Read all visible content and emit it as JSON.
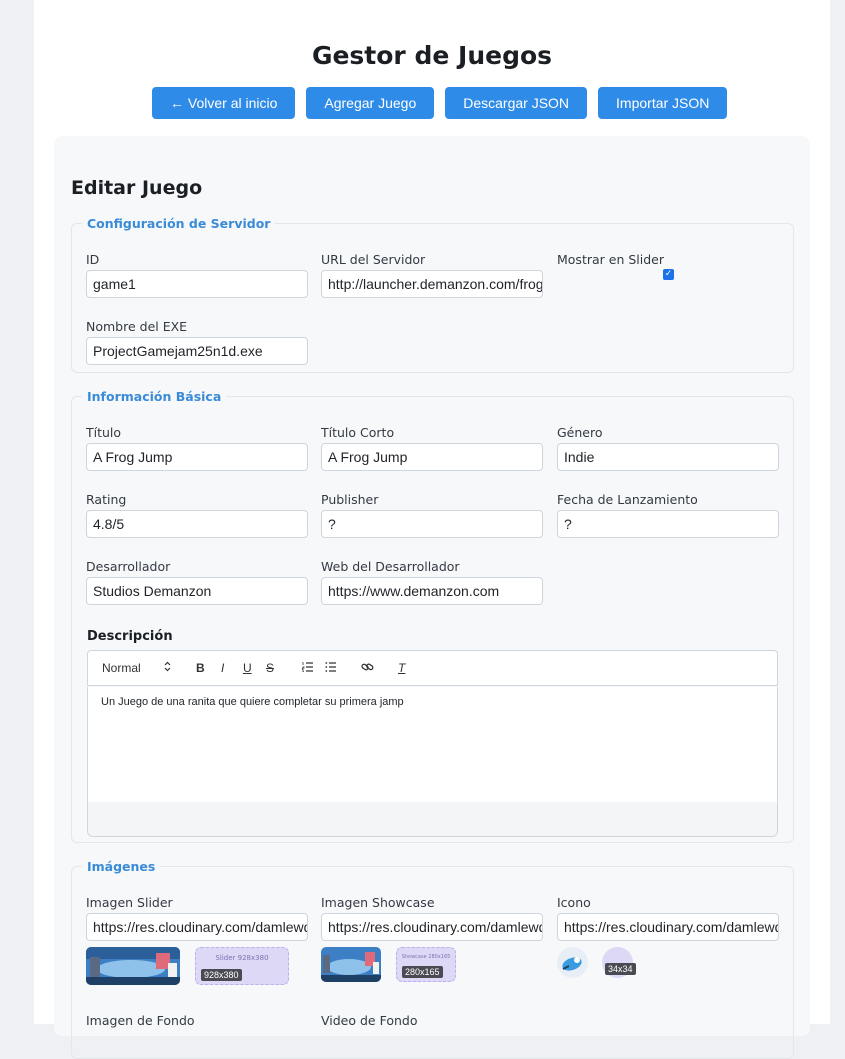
{
  "header": {
    "title": "Gestor de Juegos",
    "buttons": {
      "back": "← Volver al inicio",
      "add": "Agregar Juego",
      "download": "Descargar JSON",
      "import": "Importar JSON"
    }
  },
  "form": {
    "title": "Editar Juego",
    "server_section": {
      "legend": "Configuración de Servidor",
      "id_label": "ID",
      "id_value": "game1",
      "url_label": "URL del Servidor",
      "url_value": "http://launcher.demanzon.com/frog",
      "slider_label": "Mostrar en Slider",
      "slider_checked": true,
      "exe_label": "Nombre del EXE",
      "exe_value": "ProjectGamejam25n1d.exe"
    },
    "basic_section": {
      "legend": "Información Básica",
      "title_label": "Título",
      "title_value": "A Frog Jump",
      "short_title_label": "Título Corto",
      "short_title_value": "A Frog Jump",
      "genre_label": "Género",
      "genre_value": "Indie",
      "rating_label": "Rating",
      "rating_value": "4.8/5",
      "publisher_label": "Publisher",
      "publisher_value": "?",
      "release_label": "Fecha de Lanzamiento",
      "release_value": "?",
      "developer_label": "Desarrollador",
      "developer_value": "Studios Demanzon",
      "web_label": "Web del Desarrollador",
      "web_value": "https://www.demanzon.com",
      "description_label": "Descripción",
      "editor": {
        "format_select": "Normal",
        "bold": "B",
        "italic": "I",
        "underline": "U",
        "strike": "S",
        "ordered_list_icon": "ordered-list-icon",
        "bullet_list_icon": "bullet-list-icon",
        "link_icon": "link-icon",
        "clear_format": "T",
        "content": "Un Juego de una ranita que quiere completar su primera jamp"
      }
    },
    "images_section": {
      "legend": "Imágenes",
      "slider_label": "Imagen Slider",
      "slider_value": "https://res.cloudinary.com/damlewqw",
      "slider_placeholder_text": "Slider 928x380",
      "slider_dim": "928x380",
      "showcase_label": "Imagen Showcase",
      "showcase_value": "https://res.cloudinary.com/damlewqw",
      "showcase_placeholder_text": "Showcase 280x165",
      "showcase_dim": "280x165",
      "icon_label": "Icono",
      "icon_value": "https://res.cloudinary.com/damlewqw",
      "icon_dim": "34x34",
      "background_label": "Imagen de Fondo",
      "video_label": "Video de Fondo"
    }
  },
  "colors": {
    "accent": "#2f8be8",
    "legend": "#3a8bd8",
    "placeholder": "#ddd8f6"
  }
}
